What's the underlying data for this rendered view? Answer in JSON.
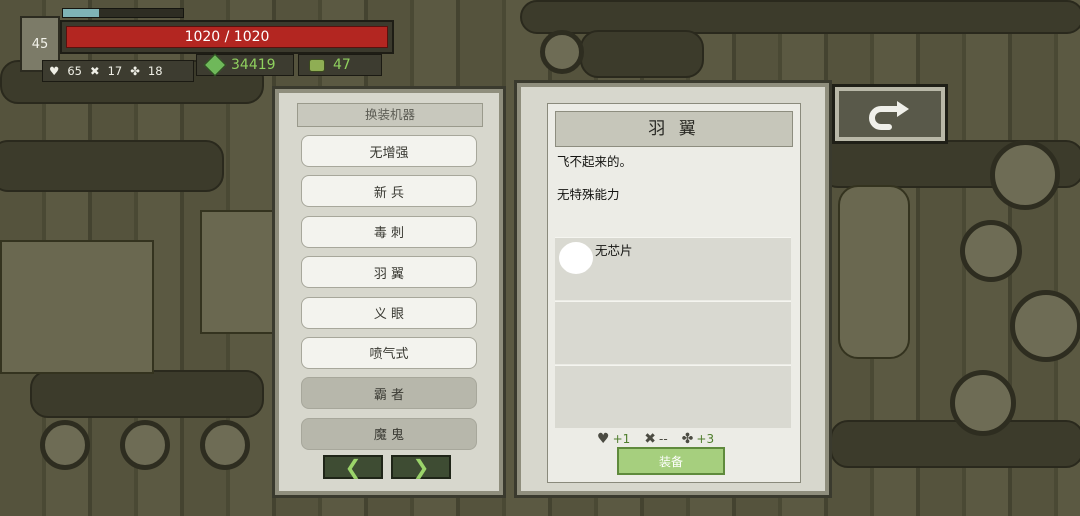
{
  "hud": {
    "level": "45",
    "xp_fraction": 0.3,
    "hp_text": "1020 / 1020",
    "hp_fraction": 1.0,
    "stat_heart": "65",
    "stat_x": "17",
    "stat_clover": "18",
    "currency_gems": "34419",
    "currency_chips": "47"
  },
  "left_panel": {
    "title": "换装机器",
    "items": [
      {
        "label": "无增强",
        "style": "light"
      },
      {
        "label": "新 兵",
        "style": "light"
      },
      {
        "label": "毒 刺",
        "style": "light"
      },
      {
        "label": "羽 翼",
        "style": "light"
      },
      {
        "label": "义 眼",
        "style": "light"
      },
      {
        "label": "喷气式",
        "style": "light"
      },
      {
        "label": "霸 者",
        "style": "dark"
      },
      {
        "label": "魔 鬼",
        "style": "dark"
      }
    ],
    "prev_icon": "chevron-left-icon",
    "next_icon": "chevron-right-icon"
  },
  "right_panel": {
    "title": "羽 翼",
    "desc_line1": "飞不起来的。",
    "desc_line2": "无特殊能力",
    "chip_slot_label": "无芯片",
    "bonus_heart": "+1",
    "bonus_x": "--",
    "bonus_clover": "+3",
    "equip_label": "装备"
  },
  "back_button_icon": "return-arrow-icon",
  "colors": {
    "hp_red": "#b32621",
    "accent_green": "#8fd05e",
    "equip_green": "#a6cf7e"
  }
}
